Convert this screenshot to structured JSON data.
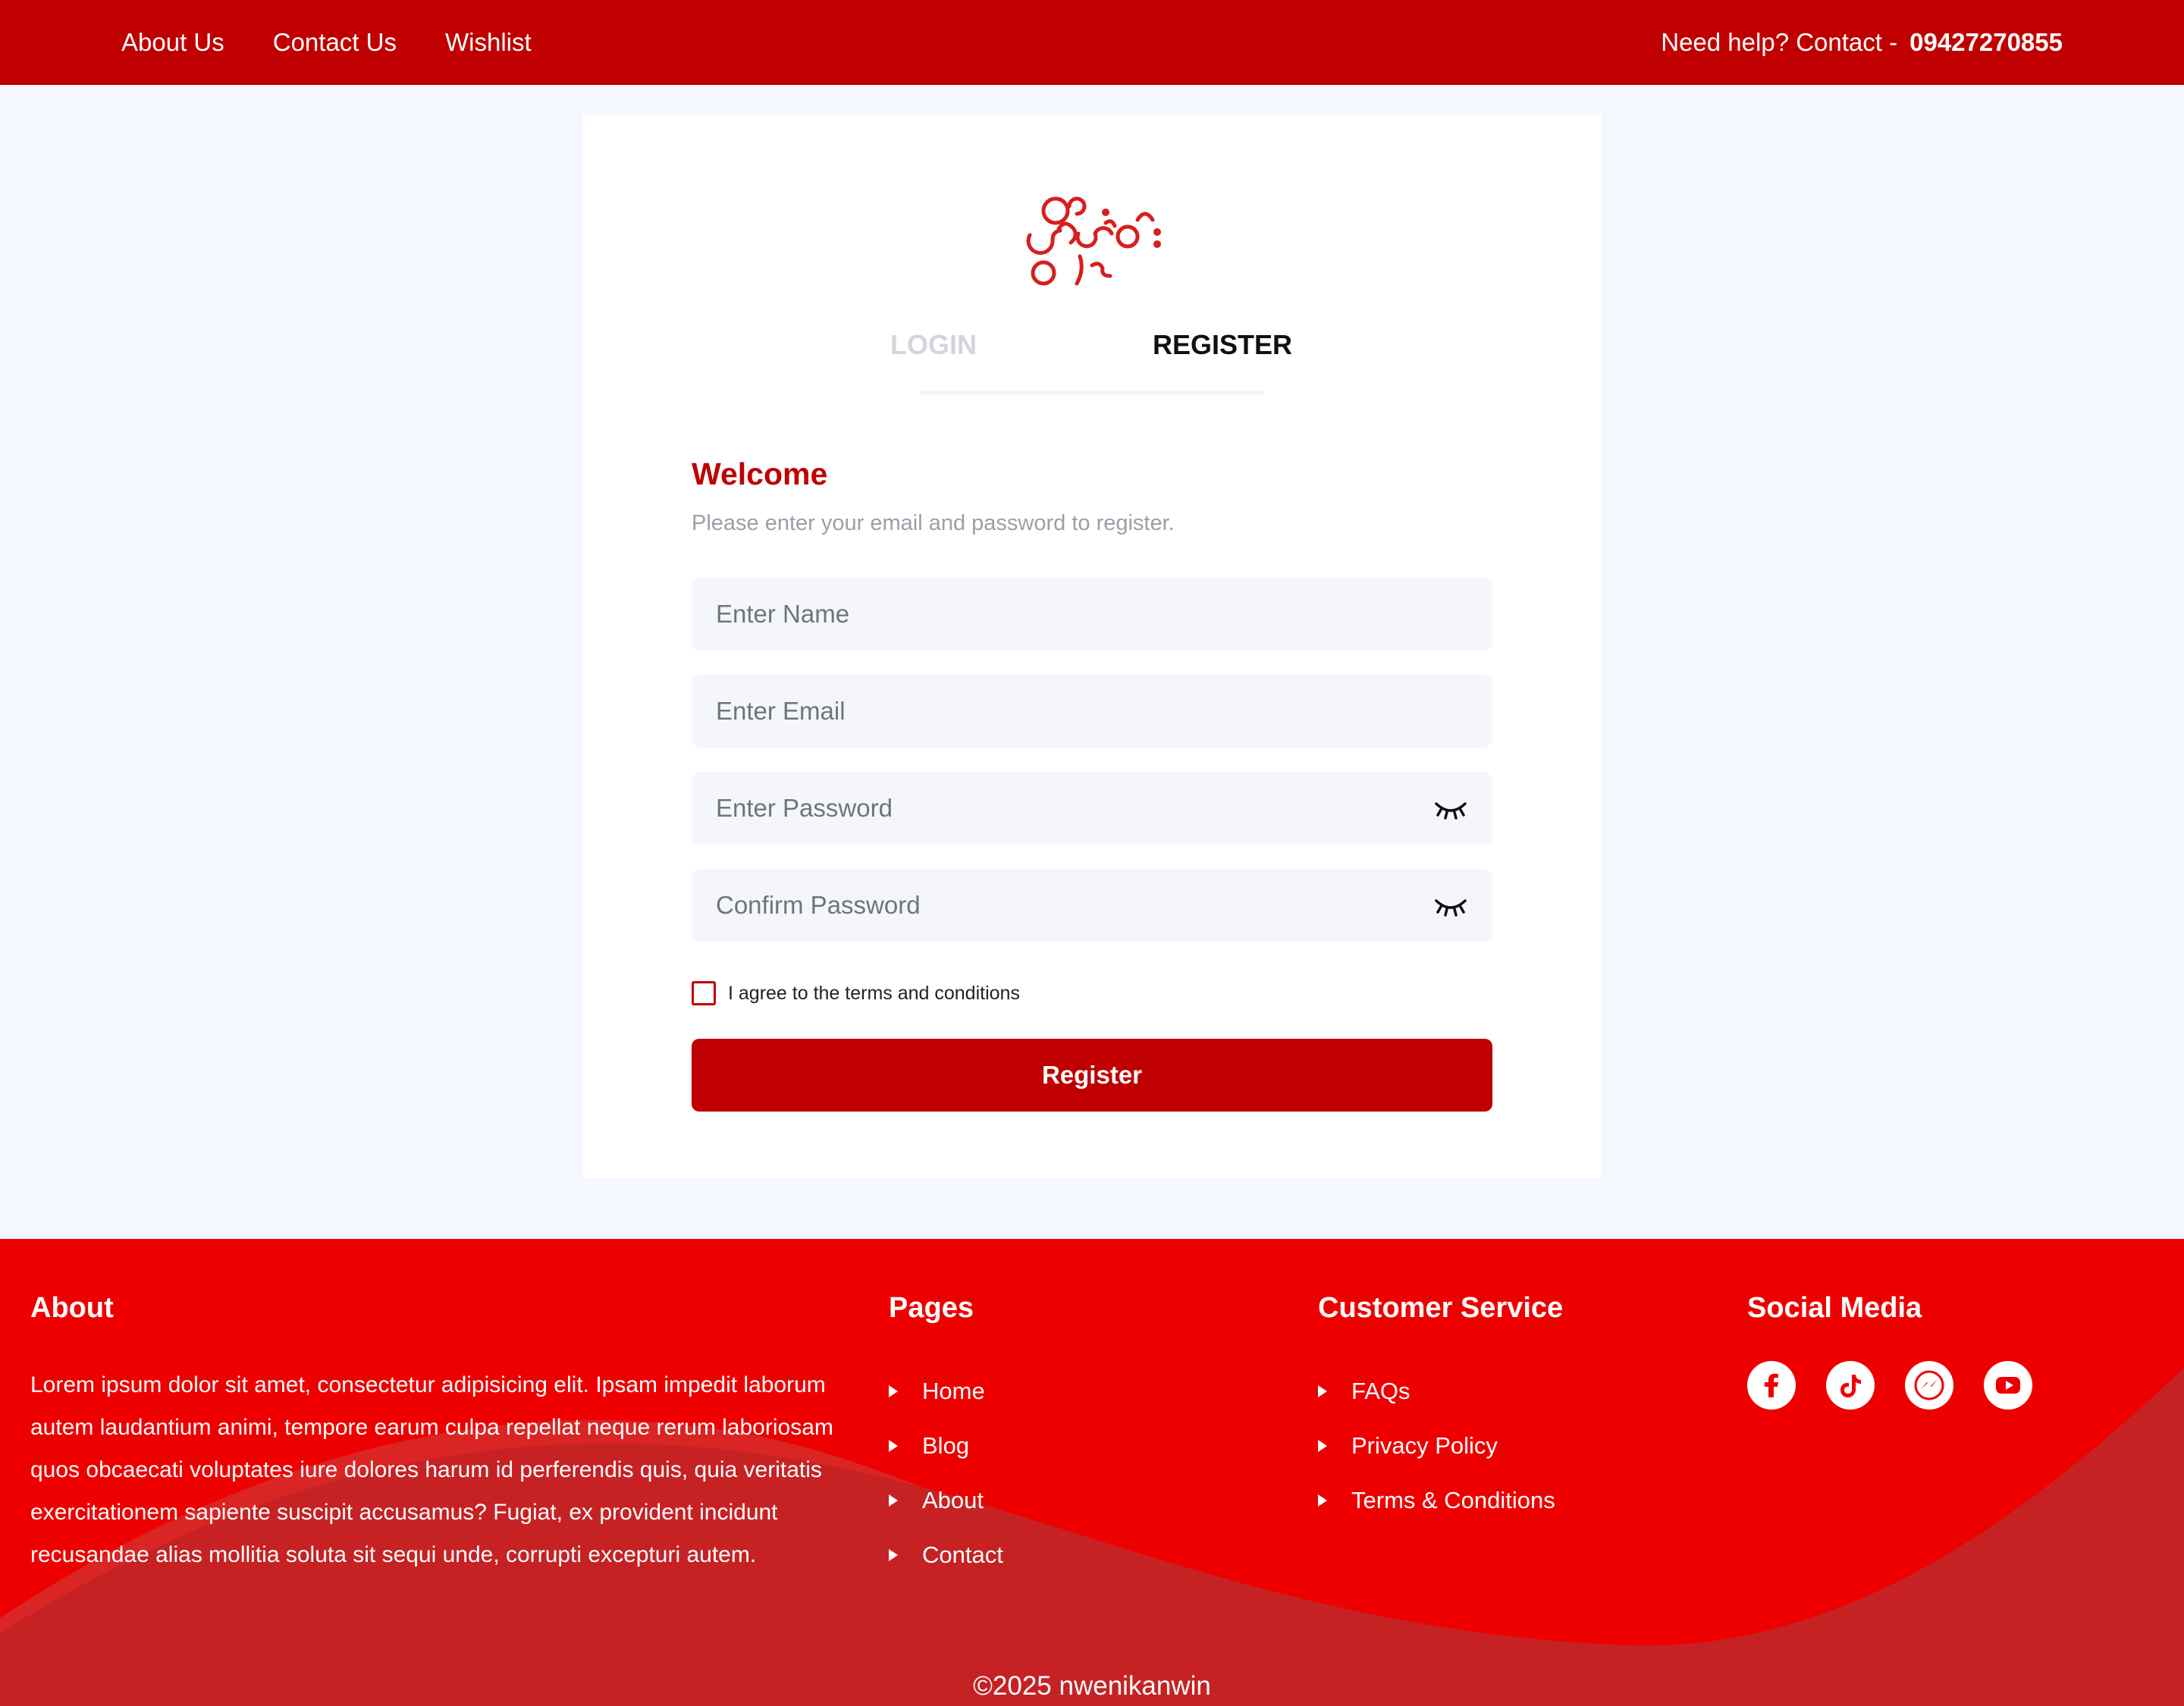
{
  "topbar": {
    "nav": [
      "About Us",
      "Contact Us",
      "Wishlist"
    ],
    "help_text": "Need help? Contact -",
    "phone": "09427270855"
  },
  "auth": {
    "tabs": {
      "login": "LOGIN",
      "register": "REGISTER"
    },
    "active_tab": "REGISTER",
    "welcome": "Welcome",
    "subtitle": "Please enter your email and password to register.",
    "fields": {
      "name_placeholder": "Enter Name",
      "email_placeholder": "Enter Email",
      "password_placeholder": "Enter Password",
      "confirm_placeholder": "Confirm Password"
    },
    "agree_label": "I agree to the terms and conditions",
    "submit_label": "Register"
  },
  "footer": {
    "about": {
      "title": "About",
      "text": "Lorem ipsum dolor sit amet, consectetur adipisicing elit. Ipsam impedit laborum autem laudantium animi, tempore earum culpa repellat neque rerum laboriosam quos obcaecati voluptates iure dolores harum id perferendis quis, quia veritatis exercitationem sapiente suscipit accusamus? Fugiat, ex provident incidunt recusandae alias mollitia soluta sit sequi unde, corrupti excepturi autem."
    },
    "pages": {
      "title": "Pages",
      "links": [
        "Home",
        "Blog",
        "About",
        "Contact"
      ]
    },
    "customer_service": {
      "title": "Customer Service",
      "links": [
        "FAQs",
        "Privacy Policy",
        "Terms & Conditions"
      ]
    },
    "social": {
      "title": "Social Media",
      "icons": [
        "facebook-icon",
        "tiktok-icon",
        "messenger-icon",
        "youtube-icon"
      ]
    },
    "copyright": "©2025 nwenikanwin"
  },
  "colors": {
    "brand_red": "#c00000",
    "footer_red": "#ee0000",
    "wave_red": "#c62224",
    "page_bg": "#f4f7fd"
  }
}
